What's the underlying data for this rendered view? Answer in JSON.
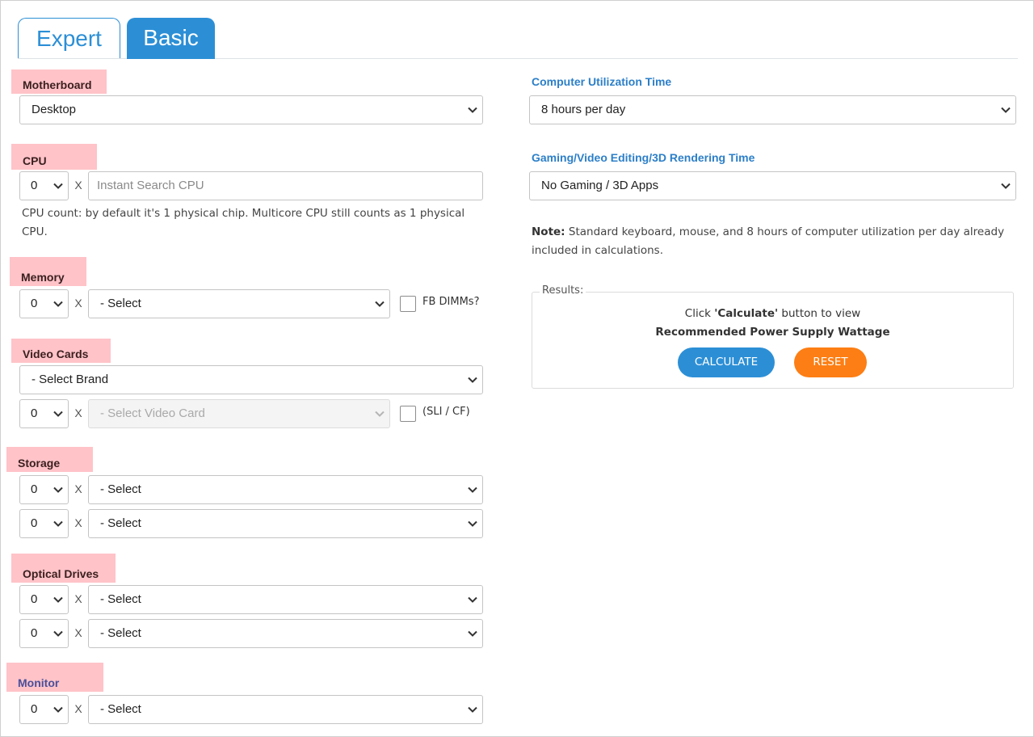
{
  "tabs": {
    "expert": "Expert",
    "basic": "Basic"
  },
  "motherboard": {
    "label": "Motherboard",
    "value": "Desktop"
  },
  "cpu": {
    "label": "CPU",
    "count": "0",
    "x": "X",
    "search_placeholder": "Instant Search CPU",
    "help_line1": "CPU count: by default it's 1 physical chip. Multicore CPU still counts as 1 physical",
    "help_line2": "CPU."
  },
  "memory": {
    "label": "Memory",
    "count": "0",
    "x": "X",
    "value": "- Select",
    "checkbox_label": "FB DIMMs?"
  },
  "video_cards": {
    "label": "Video Cards",
    "brand": "- Select Brand",
    "count": "0",
    "x": "X",
    "card": "- Select Video Card",
    "checkbox_label": "(SLI / CF)"
  },
  "storage": {
    "label": "Storage",
    "rows": [
      {
        "count": "0",
        "x": "X",
        "value": "- Select"
      },
      {
        "count": "0",
        "x": "X",
        "value": "- Select"
      }
    ]
  },
  "optical": {
    "label": "Optical Drives",
    "rows": [
      {
        "count": "0",
        "x": "X",
        "value": "- Select"
      },
      {
        "count": "0",
        "x": "X",
        "value": "- Select"
      }
    ]
  },
  "monitor": {
    "label": "Monitor",
    "count": "0",
    "x": "X",
    "value": "- Select"
  },
  "utilization": {
    "label": "Computer Utilization Time",
    "value": "8 hours per day"
  },
  "gaming": {
    "label": "Gaming/Video Editing/3D Rendering Time",
    "value": "No Gaming / 3D Apps"
  },
  "note": {
    "bold": "Note:",
    "text": " Standard keyboard, mouse, and 8 hours of computer utilization per day already",
    "text2": "included in calculations."
  },
  "results": {
    "legend": "Results:",
    "line1_pre": "Click ",
    "line1_bold": "'Calculate'",
    "line1_post": " button to view",
    "line2": "Recommended Power Supply Wattage",
    "calculate": "CALCULATE",
    "reset": "RESET"
  },
  "colors": {
    "accent": "#2c8fd6",
    "reset": "#fd7e14",
    "label_highlight": "#ffc3c8"
  }
}
